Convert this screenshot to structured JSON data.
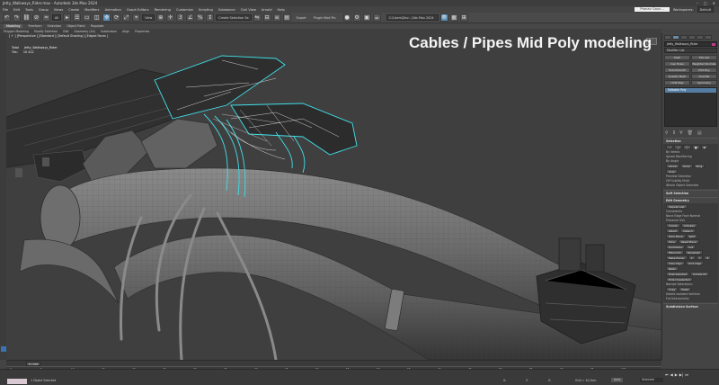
{
  "window": {
    "title": "Jetty_Walkways_Rider.max - Autodesk 3ds Max 2024",
    "controls": [
      "–",
      "▢",
      "✕"
    ]
  },
  "menu": {
    "items": [
      "File",
      "Edit",
      "Tools",
      "Group",
      "Views",
      "Create",
      "Modifiers",
      "Animation",
      "Graph Editors",
      "Rendering",
      "Customize",
      "Scripting",
      "Substance",
      "Civil View",
      "Arnold",
      "Help"
    ],
    "sign_in": "Pranav Goun...",
    "workspaces_label": "Workspaces:",
    "workspace_value": "Default"
  },
  "toolbar": {
    "selection_filter": "All",
    "view_coord": "View",
    "named_selection": "Create Selection Se",
    "export_label": "Export",
    "plugin_label": "Plugin Mod Ptc",
    "project": "C:\\Users\\Dev...\\3ds Max 2024"
  },
  "ribbon": {
    "tabs": [
      "Modeling",
      "Freeform",
      "Selection",
      "Object Paint",
      "Populate"
    ],
    "active_tab": "Modeling",
    "panels": [
      "Polygon Modeling",
      "Modify Selection",
      "Edit",
      "Geometry (All)",
      "Subdivision",
      "Align",
      "Properties"
    ]
  },
  "viewport": {
    "label": "[ + ] [Perspective ] [Standard ] [Default Shading ] [Edged Faces ]",
    "stats_name_label": "Total",
    "stats_name_value": "Jetty_Walkways_Rider",
    "stats_tris_label": "Tris:",
    "stats_tris_value": "10 412",
    "caption": "Cables / Pipes Mid Poly modeling"
  },
  "command_panel": {
    "object_name": "Jetty_Walkways_Rider",
    "modifier_list": "Modifier List",
    "buttons": [
      "Shell",
      "Extrude",
      "Cap Holes",
      "Weighted Normals",
      "TurboSmooth",
      "Edit Poly",
      "Quadify Mesh",
      "Chamfer",
      "UVW Map",
      "Symmetry"
    ],
    "stack_item": "Editable Poly",
    "selection_rollout": {
      "title": "Selection",
      "by_vertex": "By Vertex",
      "ignore_backfacing": "Ignore Backfacing",
      "by_angle": "By Angle",
      "shrink": "Shrink",
      "grow": "Grow",
      "ring": "Ring",
      "loop": "Loop",
      "preview_selection": "Preview Selection",
      "off": "Off",
      "subobj": "SubObj",
      "multi": "Multi",
      "whole_object": "Whole Object Selected"
    },
    "soft_selection": "Soft Selection",
    "edit_geometry": {
      "title": "Edit Geometry",
      "repeat_last": "Repeat Last",
      "constraints": "Constraints",
      "none": "None",
      "edge": "Edge",
      "face": "Face",
      "normal": "Normal",
      "preserve_uvs": "Preserve UVs",
      "create": "Create",
      "collapse": "Collapse",
      "attach": "Attach",
      "detach": "Detach",
      "slice_plane": "Slice Plane",
      "split": "Split",
      "slice": "Slice",
      "reset_plane": "Reset Plane",
      "quickslice": "QuickSlice",
      "cut": "Cut",
      "meshsmooth": "MSmooth",
      "tessellate": "Tessellate",
      "make_planar": "Make Planar",
      "x": "X",
      "y": "Y",
      "z": "Z",
      "view_align": "View Align",
      "grid_align": "Grid Align",
      "relax": "Relax",
      "hide_selected": "Hide Selected",
      "unhide_all": "Unhide All",
      "hide_unselected": "Hide Unselected",
      "named_selections": "Named Selections:",
      "copy": "Copy",
      "paste": "Paste",
      "delete_isolated": "Delete Isolated Vertices",
      "full_interactivity": "Full Interactivity"
    },
    "subdivision_surface": "Subdivision Surface"
  },
  "timeline": {
    "slider": "0 / 100",
    "ticks": [
      "0",
      "5",
      "10",
      "15",
      "20",
      "25",
      "30",
      "35",
      "40",
      "45",
      "50",
      "55",
      "60",
      "65",
      "70",
      "75",
      "80",
      "85",
      "90",
      "95",
      "100"
    ]
  },
  "status": {
    "objects_selected": "1 Object Selected",
    "x_label": "X:",
    "x_value": "",
    "y_label": "Y:",
    "y_value": "",
    "z_label": "Z:",
    "z_value": "",
    "grid": "Grid = 10,0cm",
    "add_time_tag": "Add Time Tag",
    "auto_key": "Auto",
    "selected": "Selected",
    "set_key": "Set K.",
    "filters": "Filters..."
  }
}
